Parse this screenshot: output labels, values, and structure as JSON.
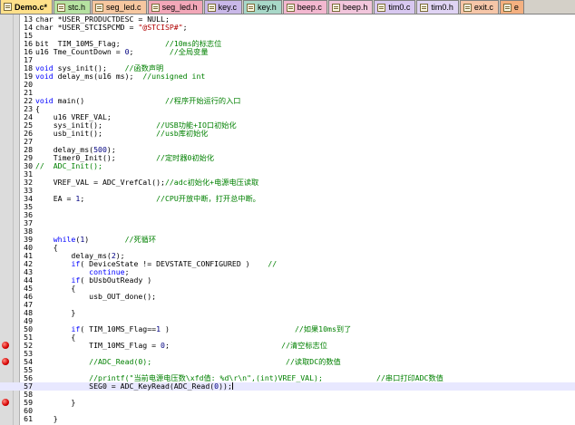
{
  "tabs": [
    {
      "label": "Demo.c*",
      "color": "#ffe08a",
      "active": true
    },
    {
      "label": "stc.h",
      "color": "#b6e2a1"
    },
    {
      "label": "seg_led.c",
      "color": "#f6c7a0"
    },
    {
      "label": "seg_led.h",
      "color": "#f2a7b8"
    },
    {
      "label": "key.c",
      "color": "#c9b8e8"
    },
    {
      "label": "key.h",
      "color": "#a8d8c8"
    },
    {
      "label": "beep.c",
      "color": "#f3b8d0"
    },
    {
      "label": "beep.h",
      "color": "#f2c6dc"
    },
    {
      "label": "tim0.c",
      "color": "#d8c8f0"
    },
    {
      "label": "tim0.h",
      "color": "#e0d4f4"
    },
    {
      "label": "exit.c",
      "color": "#f6c6a8"
    },
    {
      "label": "e",
      "color": "#f4b080"
    }
  ],
  "lines": [
    {
      "n": "13",
      "t": [
        [
          "char *USER_PRODUCTDESC = NULL;",
          ""
        ]
      ]
    },
    {
      "n": "14",
      "t": [
        [
          "char *USER_STCISPCMD = ",
          ""
        ],
        [
          "\"@STCISP#\"",
          "str"
        ],
        [
          ";",
          ""
        ]
      ]
    },
    {
      "n": "15",
      "t": []
    },
    {
      "n": "16",
      "t": [
        [
          "bit  TIM_10MS_Flag;",
          ""
        ],
        [
          "          //10ms的标志位",
          "cmt"
        ]
      ]
    },
    {
      "n": "16",
      "t": [
        [
          "u16 Tme_CountDown = ",
          ""
        ],
        [
          "0",
          "num"
        ],
        [
          ";",
          ""
        ],
        [
          "        //全局变量",
          "cmt"
        ]
      ]
    },
    {
      "n": "17",
      "t": []
    },
    {
      "n": "18",
      "t": [
        [
          "void",
          "kw"
        ],
        [
          " sys_init();    ",
          ""
        ],
        [
          "//函数声明",
          "cmt"
        ]
      ]
    },
    {
      "n": "19",
      "t": [
        [
          "void",
          "kw"
        ],
        [
          " delay_ms(u16 ms);  ",
          ""
        ],
        [
          "//unsigned int",
          "cmt"
        ]
      ]
    },
    {
      "n": "20",
      "t": []
    },
    {
      "n": "21",
      "t": []
    },
    {
      "n": "22",
      "t": [
        [
          "void",
          "kw"
        ],
        [
          " main()                  ",
          ""
        ],
        [
          "//程序开始运行的入口",
          "cmt"
        ]
      ]
    },
    {
      "n": "23",
      "t": [
        [
          "{",
          ""
        ]
      ]
    },
    {
      "n": "24",
      "t": [
        [
          "    u16 VREF_VAL;",
          ""
        ]
      ]
    },
    {
      "n": "25",
      "t": [
        [
          "    sys_init();            ",
          ""
        ],
        [
          "//USB功能+IO口初始化",
          "cmt"
        ]
      ]
    },
    {
      "n": "26",
      "t": [
        [
          "    usb_init();            ",
          ""
        ],
        [
          "//usb库初始化",
          "cmt"
        ]
      ]
    },
    {
      "n": "27",
      "t": []
    },
    {
      "n": "28",
      "t": [
        [
          "    delay_ms(",
          ""
        ],
        [
          "500",
          "num"
        ],
        [
          ");",
          ""
        ]
      ]
    },
    {
      "n": "29",
      "t": [
        [
          "    Timer0_Init();         ",
          ""
        ],
        [
          "//定时器0初始化",
          "cmt"
        ]
      ]
    },
    {
      "n": "30",
      "t": [
        [
          "//  ADC_Init();",
          "cmt"
        ]
      ]
    },
    {
      "n": "31",
      "t": []
    },
    {
      "n": "32",
      "t": [
        [
          "    VREF_VAL = ADC_VrefCal();",
          ""
        ],
        [
          "//adc初始化+电源电压读取",
          "cmt"
        ]
      ]
    },
    {
      "n": "33",
      "t": []
    },
    {
      "n": "34",
      "t": [
        [
          "    EA = ",
          ""
        ],
        [
          "1",
          "num"
        ],
        [
          ";                ",
          ""
        ],
        [
          "//CPU开放中断，打开总中断。",
          "cmt"
        ]
      ]
    },
    {
      "n": "35",
      "t": []
    },
    {
      "n": "36",
      "t": []
    },
    {
      "n": "37",
      "t": []
    },
    {
      "n": "38",
      "t": []
    },
    {
      "n": "39",
      "t": [
        [
          "    ",
          ""
        ],
        [
          "while",
          "kw"
        ],
        [
          "(",
          ""
        ],
        [
          "1",
          "num"
        ],
        [
          ")        ",
          ""
        ],
        [
          "//死循环",
          "cmt"
        ]
      ]
    },
    {
      "n": "40",
      "t": [
        [
          "    {",
          ""
        ]
      ]
    },
    {
      "n": "41",
      "t": [
        [
          "        delay_ms(",
          ""
        ],
        [
          "2",
          "num"
        ],
        [
          ");",
          ""
        ]
      ]
    },
    {
      "n": "42",
      "t": [
        [
          "        ",
          ""
        ],
        [
          "if",
          "kw"
        ],
        [
          "( DeviceState != DEVSTATE_CONFIGURED )    ",
          ""
        ],
        [
          "//",
          "cmt"
        ]
      ]
    },
    {
      "n": "43",
      "t": [
        [
          "            ",
          ""
        ],
        [
          "continue",
          "kw"
        ],
        [
          ";",
          ""
        ]
      ]
    },
    {
      "n": "44",
      "t": [
        [
          "        ",
          ""
        ],
        [
          "if",
          "kw"
        ],
        [
          "( bUsbOutReady )",
          ""
        ]
      ]
    },
    {
      "n": "45",
      "t": [
        [
          "        {",
          ""
        ]
      ]
    },
    {
      "n": "46",
      "t": [
        [
          "            usb_OUT_done();",
          ""
        ]
      ]
    },
    {
      "n": "47",
      "t": []
    },
    {
      "n": "48",
      "t": [
        [
          "        }",
          ""
        ]
      ]
    },
    {
      "n": "49",
      "t": []
    },
    {
      "n": "50",
      "t": [
        [
          "        ",
          ""
        ],
        [
          "if",
          "kw"
        ],
        [
          "( TIM_10MS_Flag==",
          ""
        ],
        [
          "1",
          "num"
        ],
        [
          " )                            ",
          ""
        ],
        [
          "//如果10ms到了",
          "cmt"
        ]
      ]
    },
    {
      "n": "51",
      "t": [
        [
          "        {",
          ""
        ]
      ]
    },
    {
      "n": "52",
      "t": [
        [
          "            TIM_10MS_Flag = ",
          ""
        ],
        [
          "0",
          "num"
        ],
        [
          ";                         ",
          ""
        ],
        [
          "//清空标志位",
          "cmt"
        ]
      ],
      "bp": true
    },
    {
      "n": "53",
      "t": []
    },
    {
      "n": "54",
      "t": [
        [
          "            ",
          ""
        ],
        [
          "//ADC_Read(0);                              //读取DC的数值",
          "cmt"
        ]
      ],
      "bp": true
    },
    {
      "n": "55",
      "t": []
    },
    {
      "n": "56",
      "t": [
        [
          "            ",
          ""
        ],
        [
          "//printf(\"当前电源电压数\\xfd值: %d\\r\\n\",(int)VREF_VAL);            //串口打印ADC数值",
          "cmt"
        ]
      ]
    },
    {
      "n": "57",
      "t": [
        [
          "            SEG0 = ADC_KeyRead(ADC_Read(",
          ""
        ],
        [
          "0",
          "num"
        ],
        [
          "));",
          ""
        ]
      ],
      "current": true
    },
    {
      "n": "58",
      "t": []
    },
    {
      "n": "59",
      "t": [
        [
          "        }",
          ""
        ]
      ],
      "bp": true
    },
    {
      "n": "60",
      "t": []
    },
    {
      "n": "61",
      "t": [
        [
          "    }",
          ""
        ]
      ]
    }
  ]
}
